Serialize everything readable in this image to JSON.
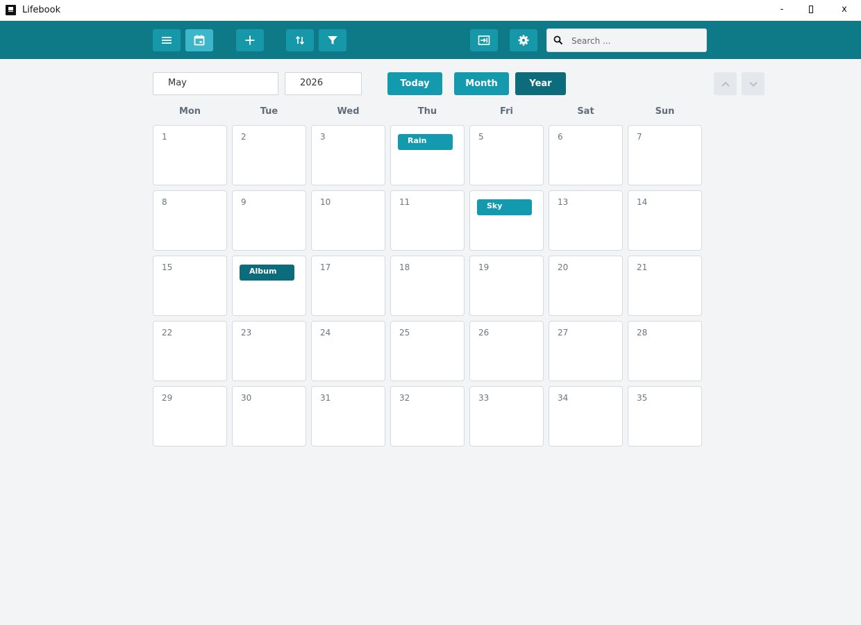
{
  "window": {
    "title": "Lifebook",
    "controls": {
      "minimize": "-",
      "close": "x"
    }
  },
  "toolbar": {
    "buttons": [
      {
        "name": "menu-button",
        "icon": "menu-icon",
        "active": false
      },
      {
        "name": "calendar-view-button",
        "icon": "calendar-icon",
        "active": true
      },
      {
        "name": "add-button",
        "icon": "plus-icon",
        "active": false
      },
      {
        "name": "sort-button",
        "icon": "sort-icon",
        "active": false
      },
      {
        "name": "filter-button",
        "icon": "filter-icon",
        "active": false
      },
      {
        "name": "import-button",
        "icon": "login-icon",
        "active": false
      },
      {
        "name": "settings-button",
        "icon": "gear-icon",
        "active": false
      }
    ],
    "search": {
      "placeholder": "Search ...",
      "value": ""
    }
  },
  "controls": {
    "month": "May",
    "year": "2026",
    "today_label": "Today",
    "month_label": "Month",
    "year_label": "Year"
  },
  "colors": {
    "toolbar_bg": "#0e7a87",
    "accent": "#149aae",
    "accent_dark": "#0c6c7b",
    "active_button": "#3eb6c9"
  },
  "calendar": {
    "weekdays": [
      "Mon",
      "Tue",
      "Wed",
      "Thu",
      "Fri",
      "Sat",
      "Sun"
    ],
    "days": [
      "1",
      "2",
      "3",
      "",
      "5",
      "6",
      "7",
      "8",
      "9",
      "10",
      "11",
      "",
      "13",
      "14",
      "15",
      "",
      "17",
      "18",
      "19",
      "20",
      "21",
      "22",
      "23",
      "24",
      "25",
      "26",
      "27",
      "28",
      "29",
      "30",
      "31",
      "32",
      "33",
      "34",
      "35"
    ],
    "events": [
      {
        "label": "Rain",
        "day_index": 3,
        "color": "#149aae"
      },
      {
        "label": "Sky",
        "day_index": 11,
        "color": "#149aae"
      },
      {
        "label": "Album",
        "day_index": 15,
        "color": "#0c6c7b"
      }
    ]
  }
}
